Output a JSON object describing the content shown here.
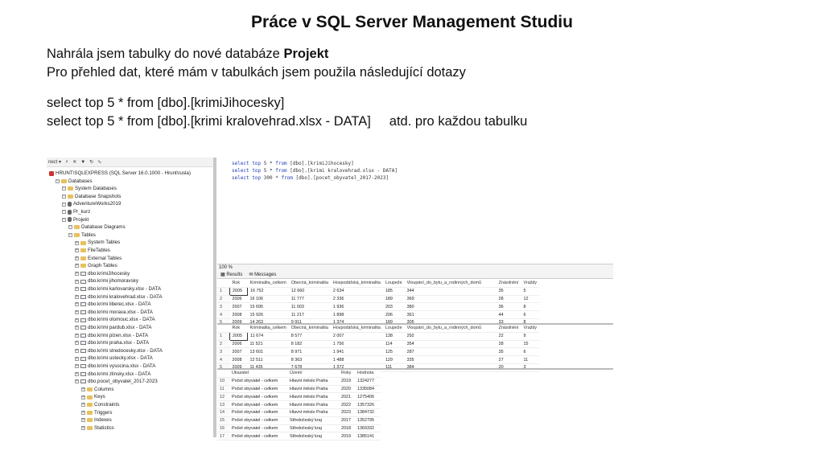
{
  "slide": {
    "title": "Práce v SQL Server Management Studiu",
    "line1_prefix": "Nahrála jsem tabulky do nové databáze ",
    "line1_bold": "Projekt",
    "line2": "Pro přehled dat, které mám v tabulkách jsem použila následující dotazy",
    "line3": "select top 5 * from [dbo].[krimiJihocesky]",
    "line4_query": "select top 5 * from [dbo].[krimi kralovehrad.xlsx - DATA]",
    "line4_suffix": "atd. pro každou tabulku"
  },
  "ssms": {
    "toolbar_connect": "nect ▾",
    "zoom": "100 %",
    "tab_results": "Results",
    "tab_messages": "Messages",
    "tree": [
      {
        "label": "HRUNT\\SQLEXPRESS (SQL Server 16.0.1000 - Hrunt\\rusla)",
        "indent": 0,
        "icon": "server"
      },
      {
        "label": "Databases",
        "indent": 1,
        "icon": "folder"
      },
      {
        "label": "System Databases",
        "indent": 2,
        "icon": "folder"
      },
      {
        "label": "Database Snapshots",
        "indent": 2,
        "icon": "folder"
      },
      {
        "label": "AdventureWorks2019",
        "indent": 2,
        "icon": "db"
      },
      {
        "label": "Pr_kurz",
        "indent": 2,
        "icon": "db"
      },
      {
        "label": "Projekt",
        "indent": 2,
        "icon": "db"
      },
      {
        "label": "Database Diagrams",
        "indent": 3,
        "icon": "folder"
      },
      {
        "label": "Tables",
        "indent": 3,
        "icon": "folder"
      },
      {
        "label": "System Tables",
        "indent": 4,
        "icon": "folder"
      },
      {
        "label": "FileTables",
        "indent": 4,
        "icon": "folder"
      },
      {
        "label": "External Tables",
        "indent": 4,
        "icon": "folder"
      },
      {
        "label": "Graph Tables",
        "indent": 4,
        "icon": "folder"
      },
      {
        "label": "dbo.krimiJihocesky",
        "indent": 4,
        "icon": "table"
      },
      {
        "label": "dbo.krimi jihomoravsky",
        "indent": 4,
        "icon": "table"
      },
      {
        "label": "dbo.krimi karlovarsky.xlsx - DATA",
        "indent": 4,
        "icon": "table"
      },
      {
        "label": "dbo.krimi kralovehrad.xlsx - DATA",
        "indent": 4,
        "icon": "table"
      },
      {
        "label": "dbo.krimi liberec.xlsx - DATA",
        "indent": 4,
        "icon": "table"
      },
      {
        "label": "dbo.krimi morava.xlsx - DATA",
        "indent": 4,
        "icon": "table"
      },
      {
        "label": "dbo.krimi olomouc.xlsx - DATA",
        "indent": 4,
        "icon": "table"
      },
      {
        "label": "dbo.krimi pardub.xlsx - DATA",
        "indent": 4,
        "icon": "table"
      },
      {
        "label": "dbo.krimi plzen.xlsx - DATA",
        "indent": 4,
        "icon": "table"
      },
      {
        "label": "dbo.krimi praha.xlsx - DATA",
        "indent": 4,
        "icon": "table"
      },
      {
        "label": "dbo.krimi stredocesky.xlsx - DATA",
        "indent": 4,
        "icon": "table"
      },
      {
        "label": "dbo.krimi ustecky.xlsx - DATA",
        "indent": 4,
        "icon": "table"
      },
      {
        "label": "dbo.krimi vysocina.xlsx - DATA",
        "indent": 4,
        "icon": "table"
      },
      {
        "label": "dbo.krimi zlinsky.xlsx - DATA",
        "indent": 4,
        "icon": "table"
      },
      {
        "label": "dbo.pocet_obyvatel_2017-2023",
        "indent": 4,
        "icon": "table"
      },
      {
        "label": "Columns",
        "indent": 5,
        "icon": "folder"
      },
      {
        "label": "Keys",
        "indent": 5,
        "icon": "folder"
      },
      {
        "label": "Constraints",
        "indent": 5,
        "icon": "folder"
      },
      {
        "label": "Triggers",
        "indent": 5,
        "icon": "folder"
      },
      {
        "label": "Indexes",
        "indent": 5,
        "icon": "folder"
      },
      {
        "label": "Statistics",
        "indent": 5,
        "icon": "folder"
      }
    ],
    "code": [
      {
        "kw1": "select",
        "kw2": "top",
        "n": "5",
        "rest": " * ",
        "from": "from",
        "obj": " [dbo].[krimiJihocesky]",
        "selected": true
      },
      {
        "kw1": "select",
        "kw2": "top",
        "n": "5",
        "rest": " * ",
        "from": "from",
        "obj": " [dbo].[krimi kralovehrad.xlsx - DATA]",
        "selected": false
      },
      {
        "kw1": "select",
        "kw2": "top",
        "n": "300",
        "rest": " * ",
        "from": "from",
        "obj": " [dbo].[pocet_obyvatel_2017-2023]",
        "selected": false
      }
    ],
    "grid1": {
      "columns": [
        "Rok",
        "Kriminalita_celkem",
        "Obecná_kriminalita",
        "Hospodářská_kriminalita",
        "Loupeže",
        "Vloupání_do_bytu_a_rodinných_domů",
        "Znásilnění",
        "Vraždy"
      ],
      "rows": [
        [
          "2005",
          "16 752",
          "12 660",
          "2 634",
          "185",
          "344",
          "35",
          "5"
        ],
        [
          "2006",
          "16 106",
          "11 777",
          "2 336",
          "189",
          "369",
          "28",
          "12"
        ],
        [
          "2007",
          "15 695",
          "11 003",
          "1 936",
          "203",
          "380",
          "36",
          "8"
        ],
        [
          "2008",
          "15 926",
          "11 217",
          "1 898",
          "206",
          "361",
          "44",
          "6"
        ],
        [
          "2009",
          "14 263",
          "9 911",
          "1 374",
          "189",
          "305",
          "33",
          "8"
        ]
      ]
    },
    "grid2": {
      "columns": [
        "Rok",
        "Kriminalita_celkem",
        "Obecná_kriminalita",
        "Hospodářská_kriminalita",
        "Loupeže",
        "Vloupání_do_bytu_a_rodinných_domů",
        "Znásilnění",
        "Vraždy"
      ],
      "rows": [
        [
          "2005",
          "11 674",
          "8 577",
          "2 007",
          "138",
          "292",
          "22",
          "9"
        ],
        [
          "2006",
          "11 521",
          "8 182",
          "1 756",
          "114",
          "354",
          "28",
          "15"
        ],
        [
          "2007",
          "13 601",
          "8 971",
          "1 941",
          "125",
          "287",
          "35",
          "6"
        ],
        [
          "2008",
          "12 511",
          "8 363",
          "1 488",
          "129",
          "335",
          "27",
          "11"
        ],
        [
          "2009",
          "11 435",
          "7 678",
          "1 372",
          "111",
          "384",
          "20",
          "3"
        ]
      ]
    },
    "grid3": {
      "columns": [
        "Ukazatel",
        "Území",
        "Roky",
        "Hodnota"
      ],
      "rownums": [
        "10",
        "11",
        "12",
        "13",
        "14",
        "15",
        "16",
        "17"
      ],
      "rows": [
        [
          "Počet obyvatel - celkem",
          "Hlavní město Praha",
          "2019",
          "1324277"
        ],
        [
          "Počet obyvatel - celkem",
          "Hlavní město Praha",
          "2020",
          "1335084"
        ],
        [
          "Počet obyvatel - celkem",
          "Hlavní město Praha",
          "2021",
          "1275406"
        ],
        [
          "Počet obyvatel - celkem",
          "Hlavní město Praha",
          "2022",
          "1357326"
        ],
        [
          "Počet obyvatel - celkem",
          "Hlavní město Praha",
          "2023",
          "1384732"
        ],
        [
          "Počet obyvatel - celkem",
          "Středočeský kraj",
          "2017",
          "1352795"
        ],
        [
          "Počet obyvatel - celkem",
          "Středočeský kraj",
          "2018",
          "1369332"
        ],
        [
          "Počet obyvatel - celkem",
          "Středočeský kraj",
          "2019",
          "1385141"
        ]
      ]
    }
  }
}
